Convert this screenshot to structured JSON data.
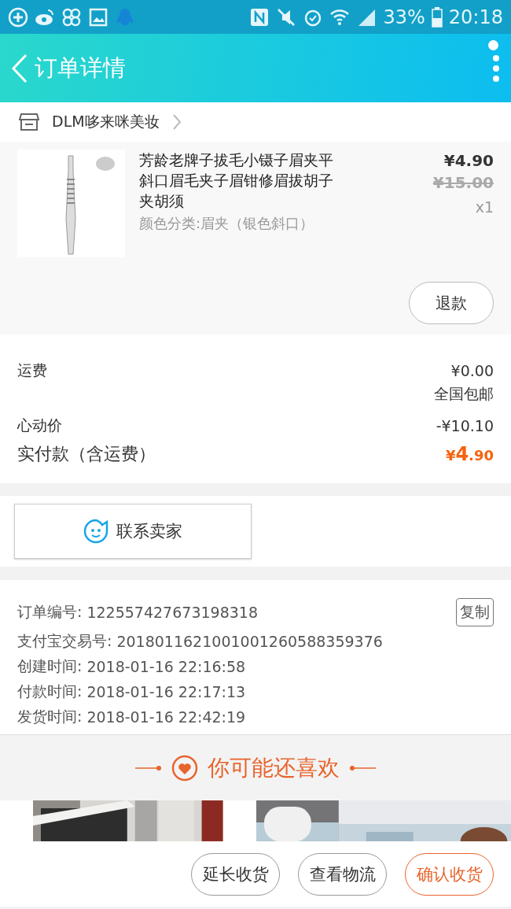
{
  "status_bar": {
    "battery": "33%",
    "time": "20:18"
  },
  "header": {
    "title": "订单详情"
  },
  "shop": {
    "name": "DLM哆来咪美妆"
  },
  "product": {
    "title": "芳龄老牌子拔毛小镊子眉夹平斜口眉毛夹子眉钳修眉拔胡子夹胡须",
    "variant": "颜色分类:眉夹（银色斜口）",
    "price": "¥4.90",
    "original_price": "¥15.00",
    "quantity": "x1",
    "refund_button": "退款"
  },
  "fees": [
    {
      "label": "运费",
      "value": "¥0.00",
      "note": "全国包邮"
    },
    {
      "label": "心动价",
      "value": "-¥10.10"
    }
  ],
  "total": {
    "label": "实付款（含运费）",
    "currency": "¥",
    "integer": "4",
    "decimal": ".90"
  },
  "contact_button": "联系卖家",
  "order_info": [
    {
      "label": "订单编号:",
      "value": "122557427673198318",
      "action": "复制"
    },
    {
      "label": "支付宝交易号:",
      "value": "2018011621001001260588359376"
    },
    {
      "label": "创建时间:",
      "value": "2018-01-16 22:16:58"
    },
    {
      "label": "付款时间:",
      "value": "2018-01-16 22:17:13"
    },
    {
      "label": "发货时间:",
      "value": "2018-01-16 22:42:19"
    }
  ],
  "recommend": {
    "title": "你可能还喜欢"
  },
  "actions": [
    {
      "label": "延长收货",
      "primary": false
    },
    {
      "label": "查看物流",
      "primary": false
    },
    {
      "label": "确认收货",
      "primary": true
    }
  ]
}
